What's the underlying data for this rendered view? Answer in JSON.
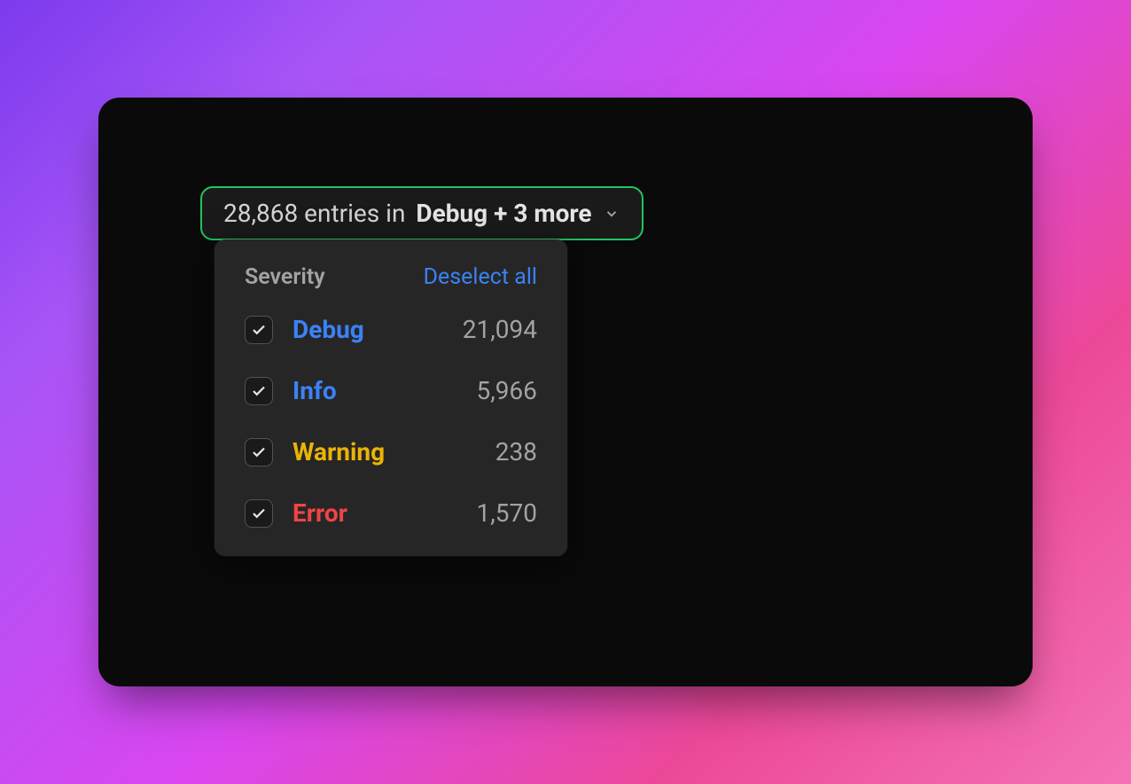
{
  "trigger": {
    "prefix": "28,868 entries in ",
    "selection": "Debug + 3 more"
  },
  "panel": {
    "title": "Severity",
    "deselect_label": "Deselect all",
    "options": [
      {
        "label": "Debug",
        "count": "21,094",
        "color_class": "color-debug",
        "checked": true
      },
      {
        "label": "Info",
        "count": "5,966",
        "color_class": "color-info",
        "checked": true
      },
      {
        "label": "Warning",
        "count": "238",
        "color_class": "color-warning",
        "checked": true
      },
      {
        "label": "Error",
        "count": "1,570",
        "color_class": "color-error",
        "checked": true
      }
    ]
  }
}
